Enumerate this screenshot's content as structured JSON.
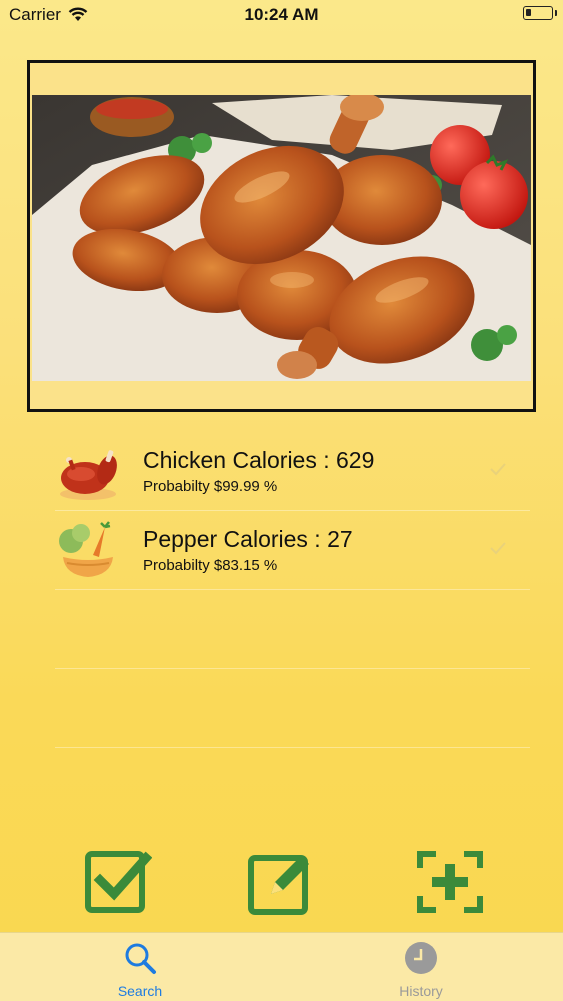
{
  "status_bar": {
    "carrier": "Carrier",
    "time": "10:24 AM"
  },
  "photo": {
    "subject": "roasted chicken drumsticks with tomatoes"
  },
  "results": [
    {
      "title": "Chicken Calories : 629",
      "probability": "Probabilty $99.99 %",
      "icon": "roast-chicken-icon"
    },
    {
      "title": "Pepper Calories : 27",
      "probability": "Probabilty $83.15 %",
      "icon": "vegetable-bowl-icon"
    }
  ],
  "actions": [
    {
      "icon": "checkbox-icon"
    },
    {
      "icon": "edit-icon"
    },
    {
      "icon": "scan-add-icon"
    }
  ],
  "tabs": [
    {
      "label": "Search",
      "icon": "search-icon",
      "active": true
    },
    {
      "label": "History",
      "icon": "clock-icon",
      "active": false
    }
  ],
  "colors": {
    "accent": "#1e7be0",
    "button_green": "#3b8a3a",
    "background": "#fbe07a"
  }
}
